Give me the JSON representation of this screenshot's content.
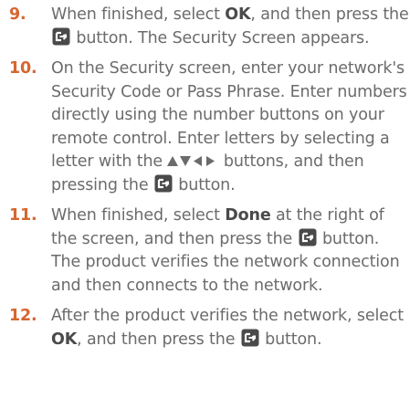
{
  "steps": [
    {
      "number": "9.",
      "t1": "When finished, select ",
      "b1": "OK",
      "t2": ", and then press the ",
      "t3": " button. The Security Screen appears."
    },
    {
      "number": "10.",
      "t1": "On the Security screen, enter your network's Security Code or Pass Phrase. Enter numbers directly using the number buttons on your remote control. Enter letters by selecting a letter with the ",
      "t2": " buttons, and then pressing the ",
      "t3": " button."
    },
    {
      "number": "11.",
      "t1": "When finished, select ",
      "b1": "Done",
      "t2": " at the right of the screen, and then press the ",
      "t3": " button. The product verifies the network connection and then connects to the network."
    },
    {
      "number": "12.",
      "t1": "After the product verifies the network, select ",
      "b1": "OK",
      "t2": ", and then press the ",
      "t3": " button."
    }
  ],
  "icons": {
    "enter": "enter-button-icon",
    "arrows": "direction-arrows-icon"
  },
  "colors": {
    "step_number": "#d6662f",
    "body_text": "#6b6b6b",
    "bold_text": "#4a4a4a",
    "icon": "#4a4a4a"
  }
}
